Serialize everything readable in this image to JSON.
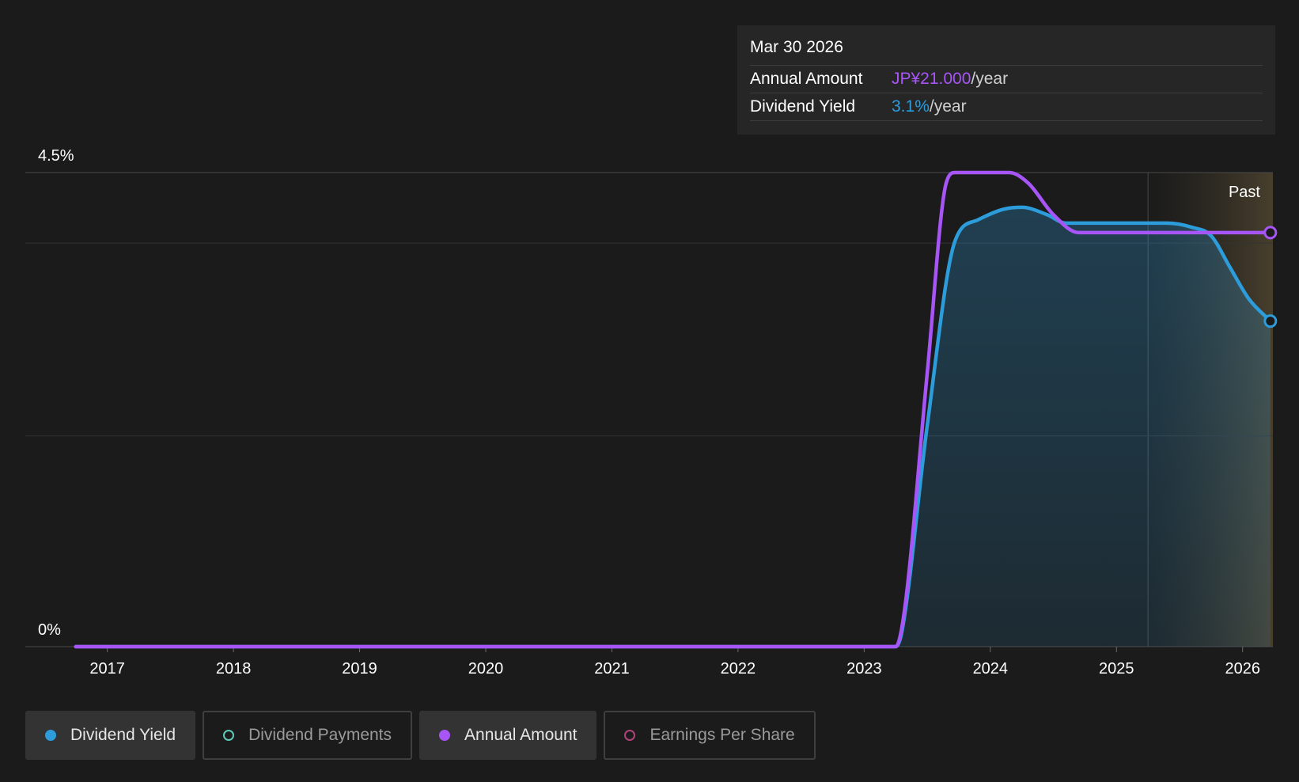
{
  "tooltip": {
    "date": "Mar 30 2026",
    "rows": [
      {
        "label": "Annual Amount",
        "value": "JP¥21.000",
        "unit": "/year",
        "color": "#a855f7"
      },
      {
        "label": "Dividend Yield",
        "value": "3.1%",
        "unit": "/year",
        "color": "#2d9cdb"
      }
    ]
  },
  "legend": [
    {
      "label": "Dividend Yield",
      "color": "#2d9cdb",
      "active": true,
      "icon": "filled-circle-icon"
    },
    {
      "label": "Dividend Payments",
      "color": "#5fcab8",
      "active": false,
      "icon": "hollow-circle-icon"
    },
    {
      "label": "Annual Amount",
      "color": "#a855f7",
      "active": true,
      "icon": "filled-circle-icon"
    },
    {
      "label": "Earnings Per Share",
      "color": "#b0447a",
      "active": false,
      "icon": "hollow-circle-icon"
    }
  ],
  "chart_data": {
    "type": "line",
    "y_ticks": [
      {
        "value": 4.5,
        "label": "4.5%"
      },
      {
        "value": 0,
        "label": "0%"
      }
    ],
    "ylim": [
      0,
      4.5
    ],
    "xlim": [
      2016.35,
      2026.24
    ],
    "x_ticks": [
      "2017",
      "2018",
      "2019",
      "2020",
      "2021",
      "2022",
      "2023",
      "2024",
      "2025",
      "2026"
    ],
    "past_label": "Past",
    "past_start": 2025.25,
    "series": [
      {
        "name": "Dividend Yield",
        "color": "#2d9cdb",
        "fill": true,
        "points": [
          [
            2016.75,
            0
          ],
          [
            2023.25,
            0
          ],
          [
            2023.3,
            0.15
          ],
          [
            2023.5,
            2.1
          ],
          [
            2023.72,
            3.85
          ],
          [
            2023.9,
            4.05
          ],
          [
            2024.1,
            4.15
          ],
          [
            2024.25,
            4.17
          ],
          [
            2024.45,
            4.1
          ],
          [
            2024.6,
            4.02
          ],
          [
            2025.0,
            4.02
          ],
          [
            2025.4,
            4.02
          ],
          [
            2025.6,
            3.98
          ],
          [
            2025.75,
            3.9
          ],
          [
            2025.9,
            3.6
          ],
          [
            2026.05,
            3.3
          ],
          [
            2026.22,
            3.09
          ]
        ]
      },
      {
        "name": "Annual Amount",
        "color": "#a855f7",
        "fill": false,
        "points": [
          [
            2016.75,
            0
          ],
          [
            2023.25,
            0
          ],
          [
            2023.32,
            0.35
          ],
          [
            2023.5,
            2.6
          ],
          [
            2023.65,
            4.4
          ],
          [
            2023.72,
            4.5
          ],
          [
            2024.15,
            4.5
          ],
          [
            2024.3,
            4.4
          ],
          [
            2024.5,
            4.1
          ],
          [
            2024.7,
            3.93
          ],
          [
            2025.0,
            3.93
          ],
          [
            2026.22,
            3.93
          ]
        ]
      }
    ]
  }
}
